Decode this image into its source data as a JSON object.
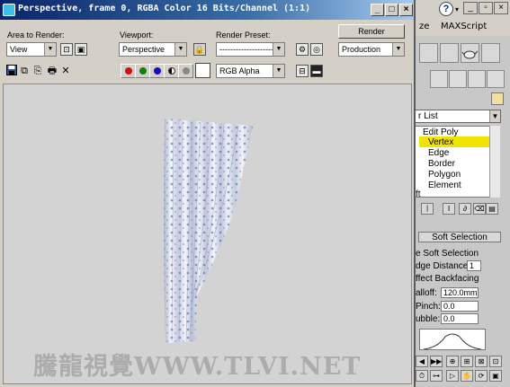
{
  "render_window": {
    "title": "Perspective, frame 0, RGBA Color 16 Bits/Channel (1:1)",
    "area_to_render": {
      "label": "Area to Render:",
      "value": "View"
    },
    "viewport": {
      "label": "Viewport:",
      "value": "Perspective"
    },
    "render_preset": {
      "label": "Render Preset:",
      "value": "--------------------"
    },
    "render_button": "Render",
    "production": "Production",
    "channel_display": "RGB Alpha",
    "channel_colors": {
      "red": "#d01010",
      "green": "#108010",
      "blue": "#1010c0"
    },
    "watermark": "騰龍視覺WWW.TLVI.NET"
  },
  "max_ui": {
    "menus": [
      "ze",
      "MAXScript"
    ],
    "help_icon": "?",
    "modifier_list": "r List",
    "stack": [
      "Edit Poly",
      "Vertex",
      "Edge",
      "Border",
      "Polygon",
      "Element",
      "ft"
    ],
    "soft_selection": {
      "header": "Soft Selection",
      "use_soft_selection": "e Soft Selection",
      "edge_distance_label": "dge Distance:",
      "edge_distance_value": "1",
      "affect_backfacing": "ffect Backfacing",
      "falloff_label": "alloff:",
      "falloff_value": "120.0mm",
      "pinch_label": "Pinch:",
      "pinch_value": "0.0",
      "bubble_label": "ubble:",
      "bubble_value": "0.0"
    }
  }
}
